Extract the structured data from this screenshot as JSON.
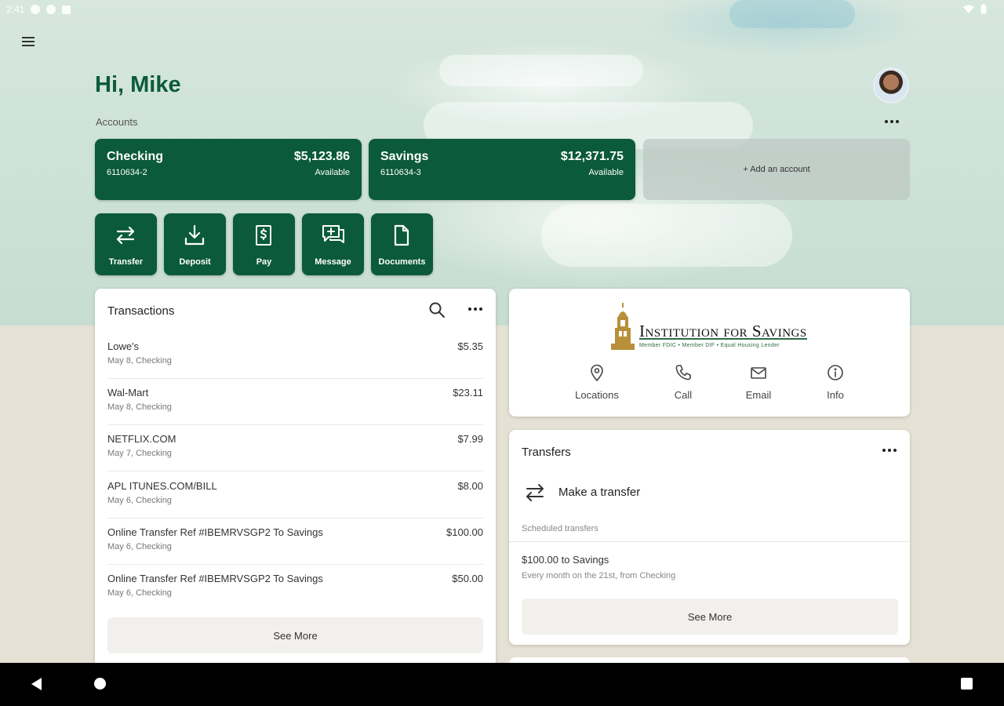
{
  "status_bar": {
    "time": "2:41"
  },
  "header": {
    "greeting": "Hi, Mike",
    "accounts_label": "Accounts"
  },
  "accounts": [
    {
      "name": "Checking",
      "number": "6110634-2",
      "balance": "$5,123.86",
      "balance_label": "Available"
    },
    {
      "name": "Savings",
      "number": "6110634-3",
      "balance": "$12,371.75",
      "balance_label": "Available"
    }
  ],
  "add_account_label": "+ Add an account",
  "actions": [
    {
      "label": "Transfer",
      "icon": "transfer-icon"
    },
    {
      "label": "Deposit",
      "icon": "deposit-icon"
    },
    {
      "label": "Pay",
      "icon": "pay-icon"
    },
    {
      "label": "Message",
      "icon": "message-icon"
    },
    {
      "label": "Documents",
      "icon": "documents-icon"
    }
  ],
  "transactions": {
    "title": "Transactions",
    "items": [
      {
        "merchant": "Lowe's",
        "sub": "May 8, Checking",
        "amount": "$5.35"
      },
      {
        "merchant": "Wal-Mart",
        "sub": "May 8, Checking",
        "amount": "$23.11"
      },
      {
        "merchant": "NETFLIX.COM",
        "sub": "May 7, Checking",
        "amount": "$7.99"
      },
      {
        "merchant": "APL ITUNES.COM/BILL",
        "sub": "May 6, Checking",
        "amount": "$8.00"
      },
      {
        "merchant": "Online Transfer Ref #IBEMRVSGP2 To Savings",
        "sub": "May 6, Checking",
        "amount": "$100.00"
      },
      {
        "merchant": "Online Transfer Ref #IBEMRVSGP2 To Savings",
        "sub": "May 6, Checking",
        "amount": "$50.00"
      }
    ],
    "see_more": "See More"
  },
  "bank": {
    "name": "Institution for Savings",
    "tagline": "Member FDIC • Member DIF • Equal Housing Lender",
    "contacts": [
      {
        "label": "Locations",
        "icon": "location-pin-icon"
      },
      {
        "label": "Call",
        "icon": "phone-icon"
      },
      {
        "label": "Email",
        "icon": "email-icon"
      },
      {
        "label": "Info",
        "icon": "info-icon"
      }
    ]
  },
  "transfers": {
    "title": "Transfers",
    "make_transfer": "Make a transfer",
    "scheduled_label": "Scheduled transfers",
    "scheduled": [
      {
        "title": "$100.00 to Savings",
        "sub": "Every month on the 21st, from Checking"
      }
    ],
    "see_more": "See More"
  },
  "colors": {
    "brand_green": "#0b5a3b",
    "background": "#e6e1d5",
    "gold": "#b8903a"
  }
}
